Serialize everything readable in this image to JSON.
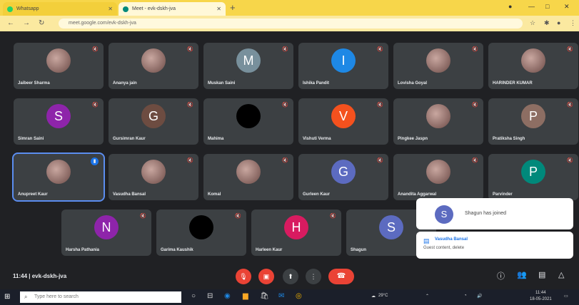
{
  "browser": {
    "tabs": [
      {
        "label": "Whatsapp",
        "color": "#25d366"
      },
      {
        "label": "Meet - evk-dskh-jva",
        "color": "#00897b"
      }
    ],
    "url": "meet.google.com/evk-dskh-jva"
  },
  "tiles": [
    {
      "name": "Jaibeer Sharma",
      "initial": "",
      "color": "",
      "photo": true,
      "row": 0,
      "col": 0
    },
    {
      "name": "Ananya jain",
      "initial": "",
      "color": "",
      "photo": true,
      "row": 0,
      "col": 1
    },
    {
      "name": "Muskan Saini",
      "initial": "M",
      "color": "#78909c",
      "photo": false,
      "row": 0,
      "col": 2
    },
    {
      "name": "Ishika Pandit",
      "initial": "I",
      "color": "#1e88e5",
      "photo": false,
      "row": 0,
      "col": 3
    },
    {
      "name": "Lovisha Goyal",
      "initial": "",
      "color": "",
      "photo": true,
      "row": 0,
      "col": 4
    },
    {
      "name": "HARINDER KUMAR",
      "initial": "",
      "color": "",
      "photo": true,
      "row": 0,
      "col": 5
    },
    {
      "name": "Simran Saini",
      "initial": "S",
      "color": "#8e24aa",
      "photo": false,
      "row": 1,
      "col": 0
    },
    {
      "name": "Gursimran Kaur",
      "initial": "G",
      "color": "#6d4c41",
      "photo": false,
      "row": 1,
      "col": 1
    },
    {
      "name": "Mahima",
      "initial": "",
      "color": "#000000",
      "photo": false,
      "row": 1,
      "col": 2
    },
    {
      "name": "Vishuti Verma",
      "initial": "V",
      "color": "#f4511e",
      "photo": false,
      "row": 1,
      "col": 3
    },
    {
      "name": "Pingkee Jaspn",
      "initial": "",
      "color": "",
      "photo": true,
      "row": 1,
      "col": 4
    },
    {
      "name": "Pratiksha Singh",
      "initial": "P",
      "color": "#8d6e63",
      "photo": false,
      "row": 1,
      "col": 5
    },
    {
      "name": "Anupreet Kaur",
      "initial": "",
      "color": "",
      "photo": true,
      "row": 2,
      "col": 0,
      "highlight": true
    },
    {
      "name": "Vasudha Bansal",
      "initial": "",
      "color": "",
      "photo": true,
      "row": 2,
      "col": 1
    },
    {
      "name": "Komal",
      "initial": "",
      "color": "",
      "photo": true,
      "row": 2,
      "col": 2
    },
    {
      "name": "Gurleen Kaur",
      "initial": "G",
      "color": "#5c6bc0",
      "photo": false,
      "row": 2,
      "col": 3
    },
    {
      "name": "Anandita Aggarwal",
      "initial": "",
      "color": "",
      "photo": true,
      "row": 2,
      "col": 4
    },
    {
      "name": "Parvinder",
      "initial": "P",
      "color": "#00897b",
      "photo": false,
      "row": 2,
      "col": 5
    },
    {
      "name": "Harsha Pathania",
      "initial": "N",
      "color": "#8e24aa",
      "photo": false,
      "row": 3,
      "col": 0
    },
    {
      "name": "Garima Kaushik",
      "initial": "",
      "color": "#000000",
      "photo": false,
      "row": 3,
      "col": 1
    },
    {
      "name": "Harleen Kaur",
      "initial": "H",
      "color": "#d81b60",
      "photo": false,
      "row": 3,
      "col": 2
    },
    {
      "name": "Shagun",
      "initial": "S",
      "color": "#5c6bc0",
      "photo": false,
      "row": 3,
      "col": 3
    }
  ],
  "notifications": {
    "join": {
      "initial": "S",
      "text": "Shagun has joined"
    },
    "guest": {
      "title": "Vasudha Bansal",
      "subtitle": "Guest content, delete"
    }
  },
  "meeting": {
    "time": "11:44",
    "code": "evk-dskh-jva"
  },
  "taskbar": {
    "search_placeholder": "Type here to search",
    "weather": "29°C",
    "clock_time": "11:44",
    "clock_date": "18-05-2021"
  }
}
